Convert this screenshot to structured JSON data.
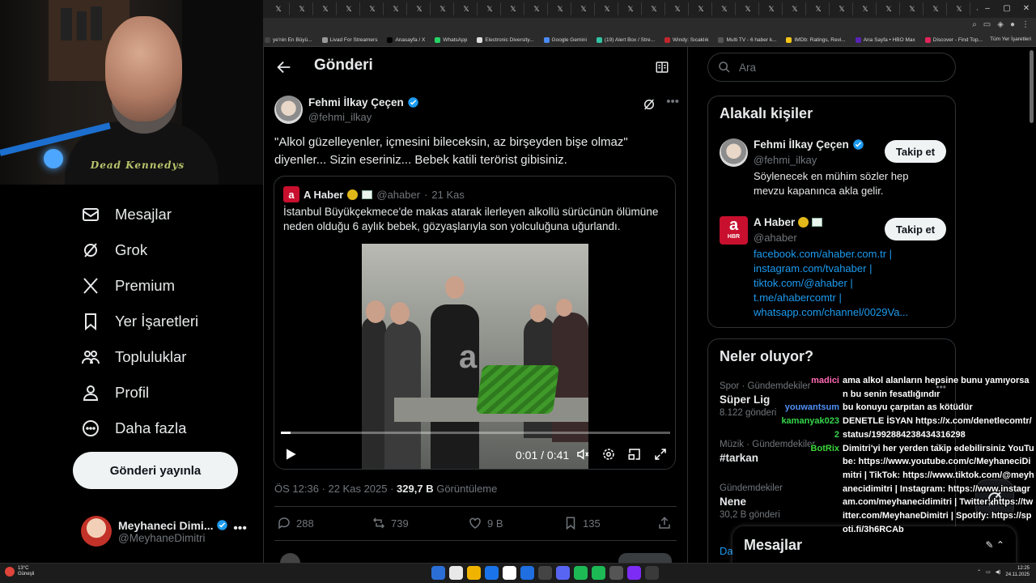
{
  "browser": {
    "tab_glyphs": [
      "𝕏",
      "𝕏",
      "𝕏",
      "𝕏",
      "𝕏",
      "𝕏",
      "𝕏",
      "𝕏",
      "𝕏",
      "𝕏",
      "𝕏",
      "𝕏",
      "𝕏",
      "𝕏",
      "𝕏",
      "𝕏",
      "𝕏",
      "𝕏",
      "𝕏",
      "𝕏",
      "𝕏",
      "𝕏",
      "𝕏",
      "𝕏",
      "𝕏",
      "𝕏",
      "𝕏",
      "𝕏",
      "𝕏",
      "𝕏"
    ],
    "new_tab": "+",
    "bookmarks": [
      {
        "label": "ye'nin En Büyü...",
        "color": "#444"
      },
      {
        "label": "Livad For Streamers",
        "color": "#999"
      },
      {
        "label": "Anasayfa / X",
        "color": "#000"
      },
      {
        "label": "WhatsApp",
        "color": "#25d366"
      },
      {
        "label": "Electronic Diversity...",
        "color": "#ddd"
      },
      {
        "label": "Google Gemini",
        "color": "#4a8af4"
      },
      {
        "label": "(19) Alert Box / Stre...",
        "color": "#31c3a2"
      },
      {
        "label": "Windy: Sıcaklık",
        "color": "#c0272d"
      },
      {
        "label": "Multi TV - 6 haber k...",
        "color": "#555"
      },
      {
        "label": "IMDb: Ratings, Revi...",
        "color": "#f5c518"
      },
      {
        "label": "Ana Sayfa • HBO Max",
        "color": "#5822b4"
      },
      {
        "label": "Discover - Find Top...",
        "color": "#e0245e"
      }
    ],
    "all_bookmarks": "Tüm Yer İşaretleri"
  },
  "webcam": {
    "shirt_text": "Dead Kennedys"
  },
  "nav": {
    "items": [
      {
        "label": "Mesajlar",
        "icon": "mail-icon"
      },
      {
        "label": "Grok",
        "icon": "grok-icon"
      },
      {
        "label": "Premium",
        "icon": "x-logo-icon"
      },
      {
        "label": "Yer İşaretleri",
        "icon": "bookmark-icon"
      },
      {
        "label": "Topluluklar",
        "icon": "communities-icon"
      },
      {
        "label": "Profil",
        "icon": "profile-icon"
      },
      {
        "label": "Daha fazla",
        "icon": "more-circle-icon"
      }
    ],
    "post_button": "Gönderi yayınla",
    "account": {
      "name": "Meyhaneci Dimi...",
      "handle": "@MeyhaneDimitri",
      "more": "•••"
    }
  },
  "main": {
    "title": "Gönderi",
    "author": {
      "name": "Fehmi İlkay Çeçen",
      "handle": "@fehmi_ilkay"
    },
    "more": "•••",
    "text": "\"Alkol güzelleyenler, içmesini bileceksin, az birşeyden bişe olmaz\" diyenler... Sizin eseriniz... Bebek katili terörist gibisiniz.",
    "quote": {
      "logo": "a",
      "name": "A Haber",
      "handle": "@ahaber",
      "separator": "·",
      "time": "21 Kas",
      "text": "İstanbul Büyükçekmece'de makas atarak ilerleyen alkollü sürücünün ölümüne neden olduğu 6 aylık bebek, gözyaşlarıyla son yolculuğuna uğurlandı.",
      "video": {
        "time": "0:01 / 0:41",
        "progress": 0.024,
        "watermark": "a"
      }
    },
    "meta": {
      "time": "ÖS 12:36 · 22 Kas 2025 · ",
      "views": "329,7 B",
      "views_label": " Görüntüleme"
    },
    "actions": {
      "replies": "288",
      "reposts": "739",
      "likes": "9 B",
      "bookmarks": "135"
    }
  },
  "right": {
    "search_placeholder": "Ara",
    "related": {
      "title": "Alakalı kişiler",
      "people": [
        {
          "name": "Fehmi İlkay Çeçen",
          "handle": "@fehmi_ilkay",
          "bio": "Söylenecek en mühim sözler hep mevzu kapanınca akla gelir.",
          "follow": "Takip et"
        },
        {
          "name": "A Haber",
          "handle": "@ahaber",
          "links": [
            "facebook.com/ahaber.com.tr |",
            "instagram.com/tvahaber |",
            "tiktok.com/@ahaber |",
            "t.me/ahabercomtr |",
            "whatsapp.com/channel/0029Va..."
          ],
          "follow": "Takip et",
          "logo_top": "a",
          "logo_bottom": "HBR"
        }
      ]
    },
    "trends": {
      "title": "Neler oluyor?",
      "items": [
        {
          "category": "Spor · Gündemdekiler",
          "name": "Süper Lig",
          "count": "8.122 gönderi"
        },
        {
          "category": "Müzik · Gündemdekiler",
          "name": "#tarkan",
          "count": ""
        },
        {
          "category": "Gündemdekiler",
          "name": "Nene",
          "count": "30,2 B gönderi"
        }
      ],
      "partial": "Da"
    },
    "messages": {
      "title": "Mesajlar",
      "icons": "✎  ⌃"
    }
  },
  "chat": [
    {
      "user": "madici",
      "color": "#ff69b4",
      "text": "ama alkol alanların hepsine bunu yamıyorsan bu senin fesatlığındır"
    },
    {
      "user": "youwantsum",
      "color": "#4f8ff7",
      "text": "bu konuyu çarpıtan as kötüdür"
    },
    {
      "user": "kamanyak0232",
      "color": "#35d54b",
      "text": "DENETLE İSYAN https://x.com/denetlecomtr/status/1992884238434316298"
    },
    {
      "user": "BotRix",
      "color": "#3bd63b",
      "text": "Dimitri'yi her yerden takip edebilirsiniz YouTube: https://www.youtube.com/c/MeyhaneciDimitri | TikTok: https://www.tiktok.com/@meyhanecidimitri | Instagram: https://www.instagram.com/meyhanecidimitri | Twitter: https://twitter.com/MeyhaneDimitri | Spotify: https://spoti.fi/3h6RCAb"
    }
  ],
  "taskbar": {
    "temp": "13°C",
    "condition": "Güneşli",
    "time": "12:25",
    "date": "24.11.2025",
    "app_colors": [
      "#2b6fd6",
      "#e8e8e8",
      "#f0b400",
      "#1a73e8",
      "#ffffff",
      "#1f6fe0",
      "#444",
      "#5865f2",
      "#1db954",
      "#1db954",
      "#555",
      "#7d2cf5",
      "#3a3a3a"
    ]
  }
}
